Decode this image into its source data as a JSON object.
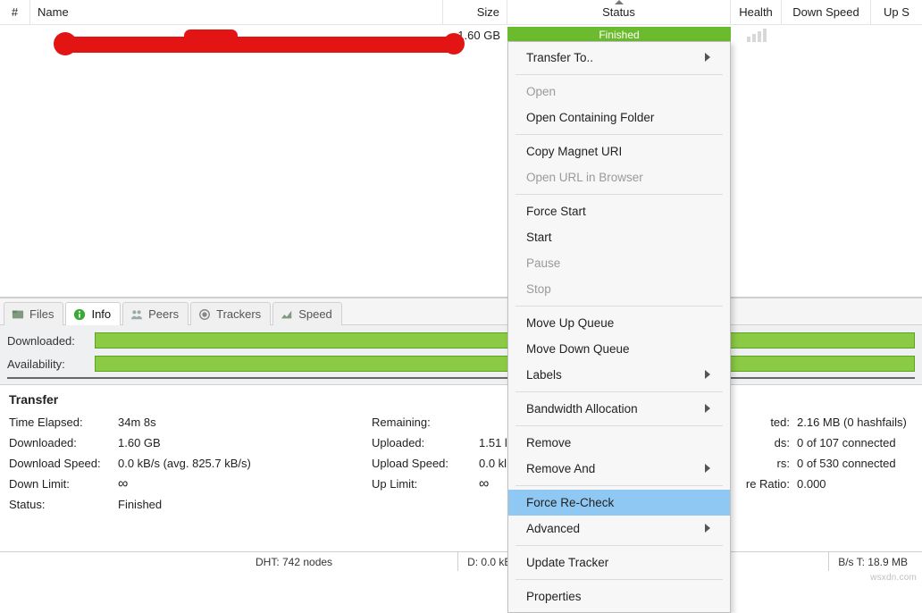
{
  "columns": {
    "num": "#",
    "name": "Name",
    "size": "Size",
    "status": "Status",
    "health": "Health",
    "down_speed": "Down Speed",
    "up_speed": "Up S"
  },
  "row": {
    "size": "1.60 GB",
    "status": "Finished"
  },
  "tabs": {
    "files": "Files",
    "info": "Info",
    "peers": "Peers",
    "trackers": "Trackers",
    "speed": "Speed"
  },
  "bars": {
    "downloaded": "Downloaded:",
    "availability": "Availability:"
  },
  "transfer": {
    "heading": "Transfer",
    "c1": {
      "time_elapsed_k": "Time Elapsed:",
      "time_elapsed_v": "34m 8s",
      "downloaded_k": "Downloaded:",
      "downloaded_v": "1.60 GB",
      "dl_speed_k": "Download Speed:",
      "dl_speed_v": "0.0 kB/s (avg. 825.7 kB/s)",
      "down_limit_k": "Down Limit:",
      "down_limit_v": "∞",
      "status_k": "Status:",
      "status_v": "Finished"
    },
    "c2": {
      "remaining_k": "Remaining:",
      "remaining_v": "",
      "uploaded_k": "Uploaded:",
      "uploaded_v": "1.51 l",
      "ul_speed_k": "Upload Speed:",
      "ul_speed_v": "0.0 kl",
      "up_limit_k": "Up Limit:",
      "up_limit_v": "∞"
    },
    "c3": {
      "wasted_k": "ted:",
      "wasted_v": "2.16 MB (0 hashfails)",
      "seeds_k": "ds:",
      "seeds_v": "0 of 107 connected",
      "peers_k": "rs:",
      "peers_v": "0 of 530 connected",
      "ratio_k": "re Ratio:",
      "ratio_v": "0.000"
    }
  },
  "statusbar": {
    "dht": "DHT: 742 nodes",
    "d": "D: 0.0 kB",
    "t": "B/s T: 18.9 MB"
  },
  "context_menu": {
    "transfer_to": "Transfer To..",
    "open": "Open",
    "open_containing": "Open Containing Folder",
    "copy_magnet": "Copy Magnet URI",
    "open_url": "Open URL in Browser",
    "force_start": "Force Start",
    "start": "Start",
    "pause": "Pause",
    "stop": "Stop",
    "move_up": "Move Up Queue",
    "move_down": "Move Down Queue",
    "labels": "Labels",
    "bandwidth": "Bandwidth Allocation",
    "remove": "Remove",
    "remove_and": "Remove And",
    "force_recheck": "Force Re-Check",
    "advanced": "Advanced",
    "update_tracker": "Update Tracker",
    "properties": "Properties"
  },
  "watermark": "wsxdn.com"
}
